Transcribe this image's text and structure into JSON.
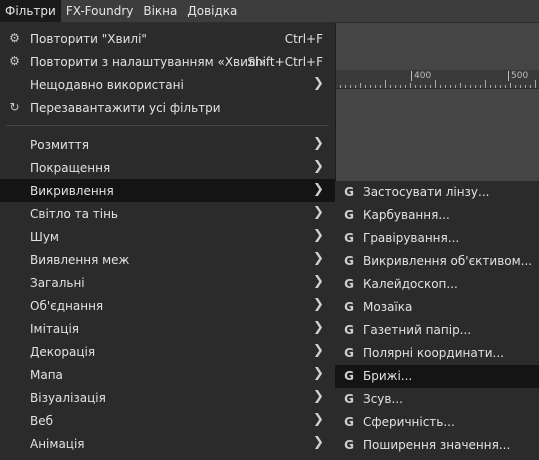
{
  "menubar": [
    "Фільтри",
    "FX-Foundry",
    "Вікна",
    "Довідка"
  ],
  "filters_menu": {
    "top_items": [
      {
        "label": "Повторити \"Хвилі\"",
        "accel": "Ctrl+F",
        "icon": "gear-icon"
      },
      {
        "label": "Повторити з налаштуванням «Хвилі»",
        "accel": "Shift+Ctrl+F",
        "icon": "gear-reset-icon"
      },
      {
        "label": "Нещодавно використані",
        "accel": "",
        "icon": ""
      },
      {
        "label": "Перезавантажити усі фільтри",
        "accel": "",
        "icon": "reload-icon"
      }
    ],
    "categories": [
      "Розмиття",
      "Покращення",
      "Викривлення",
      "Світло та тінь",
      "Шум",
      "Виявлення меж",
      "Загальні",
      "Об'єднання",
      "Імітація",
      "Декорація",
      "Мапа",
      "Візуалізація",
      "Веб",
      "Анімація"
    ],
    "highlighted_category": "Викривлення"
  },
  "distorts_submenu": {
    "icon": "gegl-icon",
    "icon_glyph": "G",
    "items": [
      "Застосувати лінзу...",
      "Карбування...",
      "Гравірування...",
      "Викривлення об'єктивом...",
      "Калейдоскоп...",
      "Мозаїка",
      "Газетний папір...",
      "Полярні координати...",
      "Брижі...",
      "Зсув...",
      "Сферичність...",
      "Поширення значення..."
    ],
    "highlighted": "Брижі..."
  },
  "ruler": {
    "labels": [
      "400",
      "500"
    ]
  },
  "colors": {
    "menu_bg": "#2b2b2b",
    "highlight": "#141414",
    "workspace": "#454545"
  }
}
